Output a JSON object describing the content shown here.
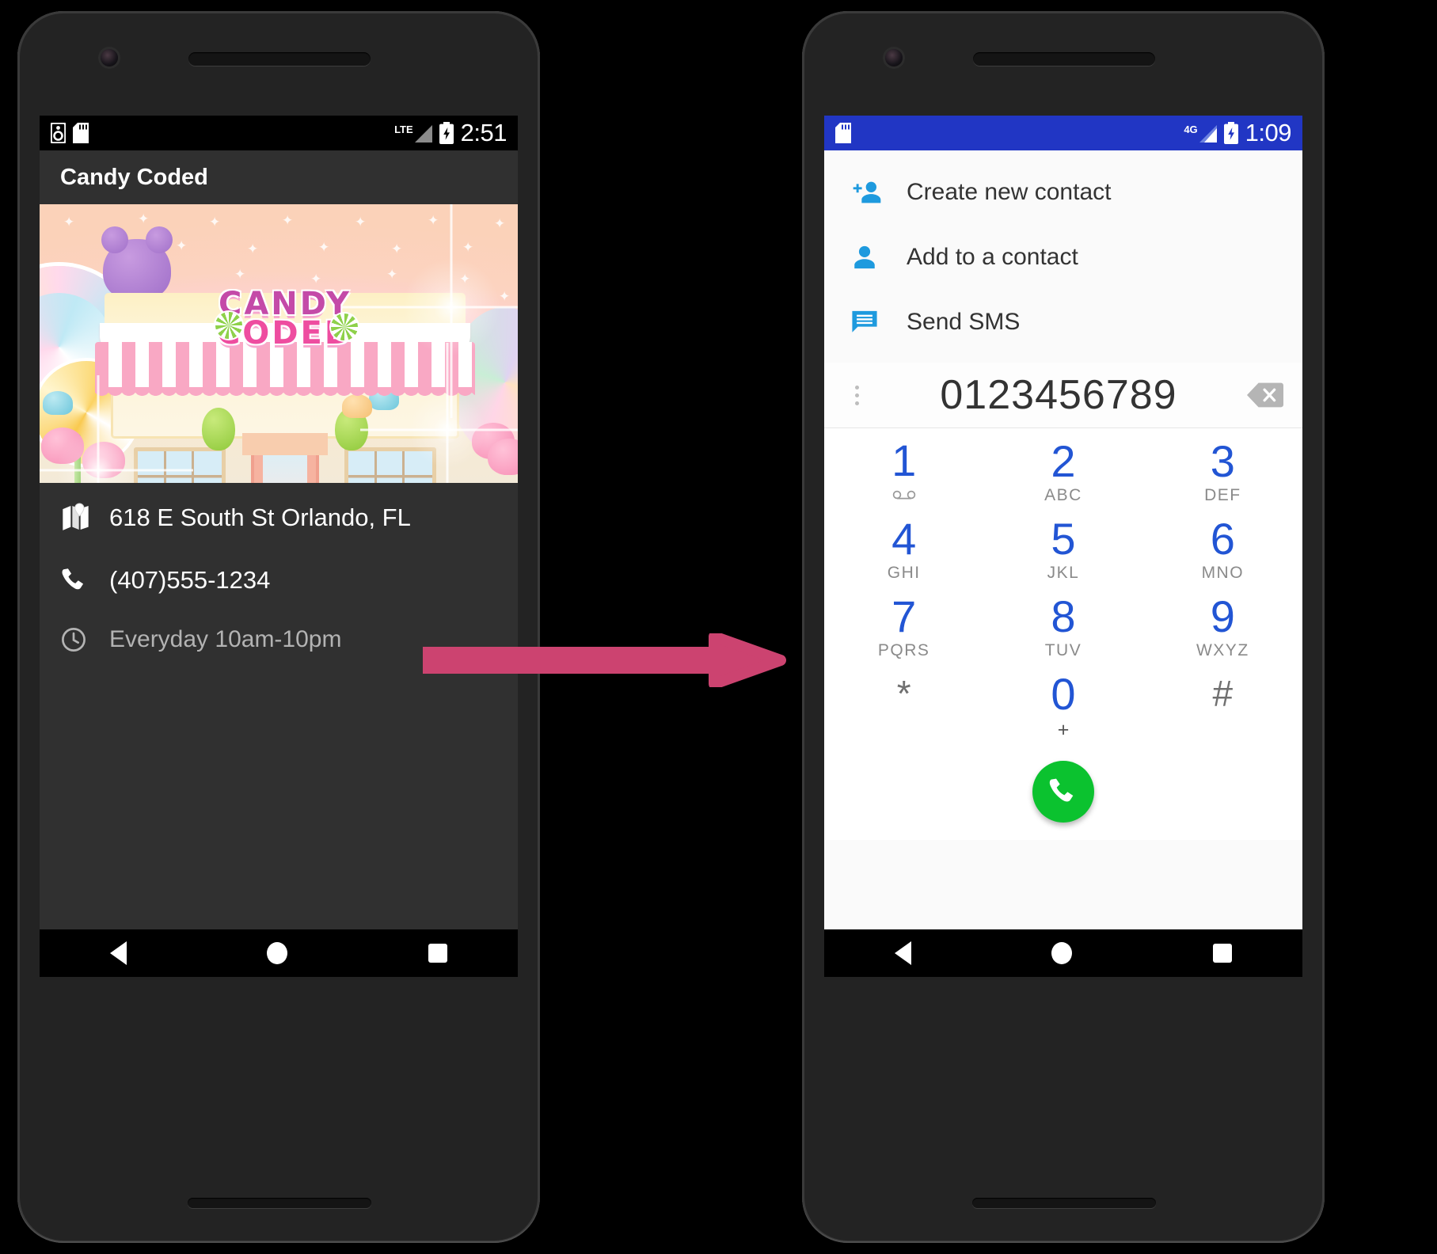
{
  "left_phone": {
    "status_bar": {
      "icons": [
        "speaker-icon",
        "sd-card-icon"
      ],
      "network_label": "LTE",
      "battery": "battery-charging-icon",
      "time": "2:51",
      "background": "#000000"
    },
    "app_bar": {
      "title": "Candy Coded",
      "background": "#303030"
    },
    "banner": {
      "sign_line1": "CANDY",
      "sign_line2": "CODED",
      "alt": "candy-shop-storefront-illustration"
    },
    "info_rows": [
      {
        "icon": "map-icon",
        "text": "618 E South St Orlando, FL",
        "muted": false
      },
      {
        "icon": "phone-icon",
        "text": "(407)555-1234",
        "muted": false
      },
      {
        "icon": "clock-icon",
        "text": "Everyday 10am-10pm",
        "muted": true
      }
    ],
    "nav_bar": {
      "back": "back-triangle-icon",
      "home": "home-circle-icon",
      "recents": "recents-square-icon"
    }
  },
  "right_phone": {
    "status_bar": {
      "icons": [
        "sd-card-icon"
      ],
      "network_label": "4G",
      "battery": "battery-charging-icon",
      "time": "1:09",
      "background": "#2136c4"
    },
    "menu_items": [
      {
        "icon": "person-add-icon",
        "label": "Create new contact"
      },
      {
        "icon": "person-icon",
        "label": "Add to a contact"
      },
      {
        "icon": "sms-icon",
        "label": "Send SMS"
      }
    ],
    "number_field": {
      "overflow_icon": "kebab-menu-icon",
      "value": "0123456789",
      "backspace_icon": "backspace-icon"
    },
    "dialpad": {
      "accent": "#2255d4",
      "keys": [
        {
          "num": "1",
          "sub": "",
          "vmail": true
        },
        {
          "num": "2",
          "sub": "ABC",
          "vmail": false
        },
        {
          "num": "3",
          "sub": "DEF",
          "vmail": false
        },
        {
          "num": "4",
          "sub": "GHI",
          "vmail": false
        },
        {
          "num": "5",
          "sub": "JKL",
          "vmail": false
        },
        {
          "num": "6",
          "sub": "MNO",
          "vmail": false
        },
        {
          "num": "7",
          "sub": "PQRS",
          "vmail": false
        },
        {
          "num": "8",
          "sub": "TUV",
          "vmail": false
        },
        {
          "num": "9",
          "sub": "WXYZ",
          "vmail": false
        },
        {
          "num": "*",
          "sub": "",
          "vmail": false
        },
        {
          "num": "0",
          "sub": "+",
          "vmail": false
        },
        {
          "num": "#",
          "sub": "",
          "vmail": false
        }
      ]
    },
    "call_button": {
      "icon": "call-icon",
      "color": "#0bc22f"
    },
    "nav_bar": {
      "back": "back-triangle-icon",
      "home": "home-circle-icon",
      "recents": "recents-square-icon"
    }
  },
  "annotation": {
    "arrow": "flow-arrow-right",
    "color": "#cc4370"
  }
}
